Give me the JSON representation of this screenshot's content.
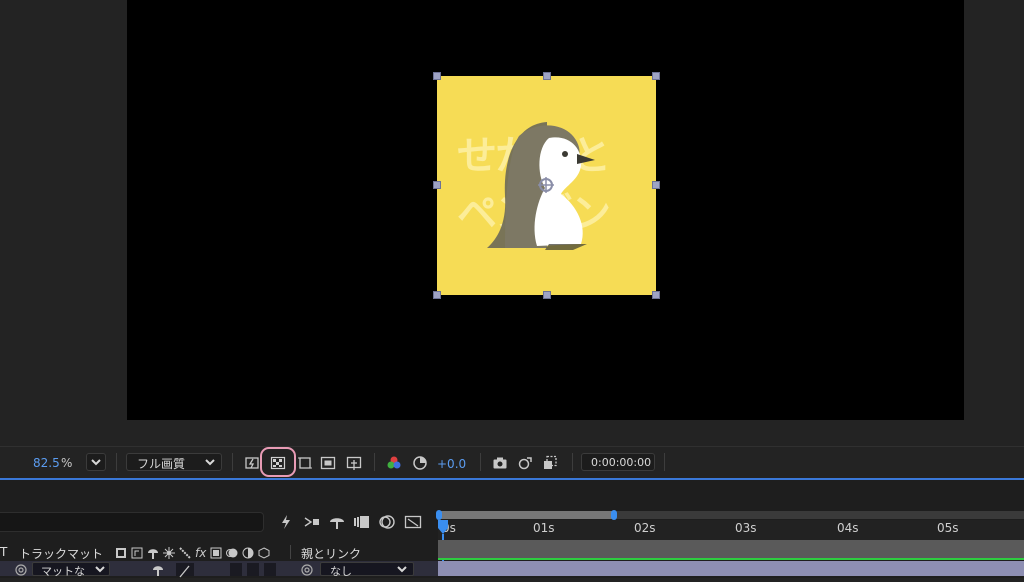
{
  "viewer": {
    "layer_text_lines": [
      "せかいと",
      "ペンギン"
    ]
  },
  "toolbar": {
    "zoom_value": "82.5",
    "zoom_unit": "%",
    "quality": "フル画質",
    "exposure": "+0.0",
    "timecode": "0:00:00:00"
  },
  "timeline": {
    "ruler_labels": [
      "0s",
      "01s",
      "02s",
      "03s",
      "04s",
      "05s"
    ],
    "columns": {
      "t_label": "T",
      "track_matte": "トラックマット",
      "parent": "親とリンク"
    },
    "row": {
      "matte_value": "マットな",
      "parent_value": "なし"
    },
    "work_area_end_fraction": 0.17
  },
  "colors": {
    "accent_blue": "#3a78d8",
    "highlight_pink": "#e89bb5",
    "layer_yellow": "#f6dc55",
    "track_green": "#2ecc40"
  },
  "icons": {
    "transparency_grid": "checkerboard-icon",
    "cursor": "arrow-cursor-icon"
  }
}
